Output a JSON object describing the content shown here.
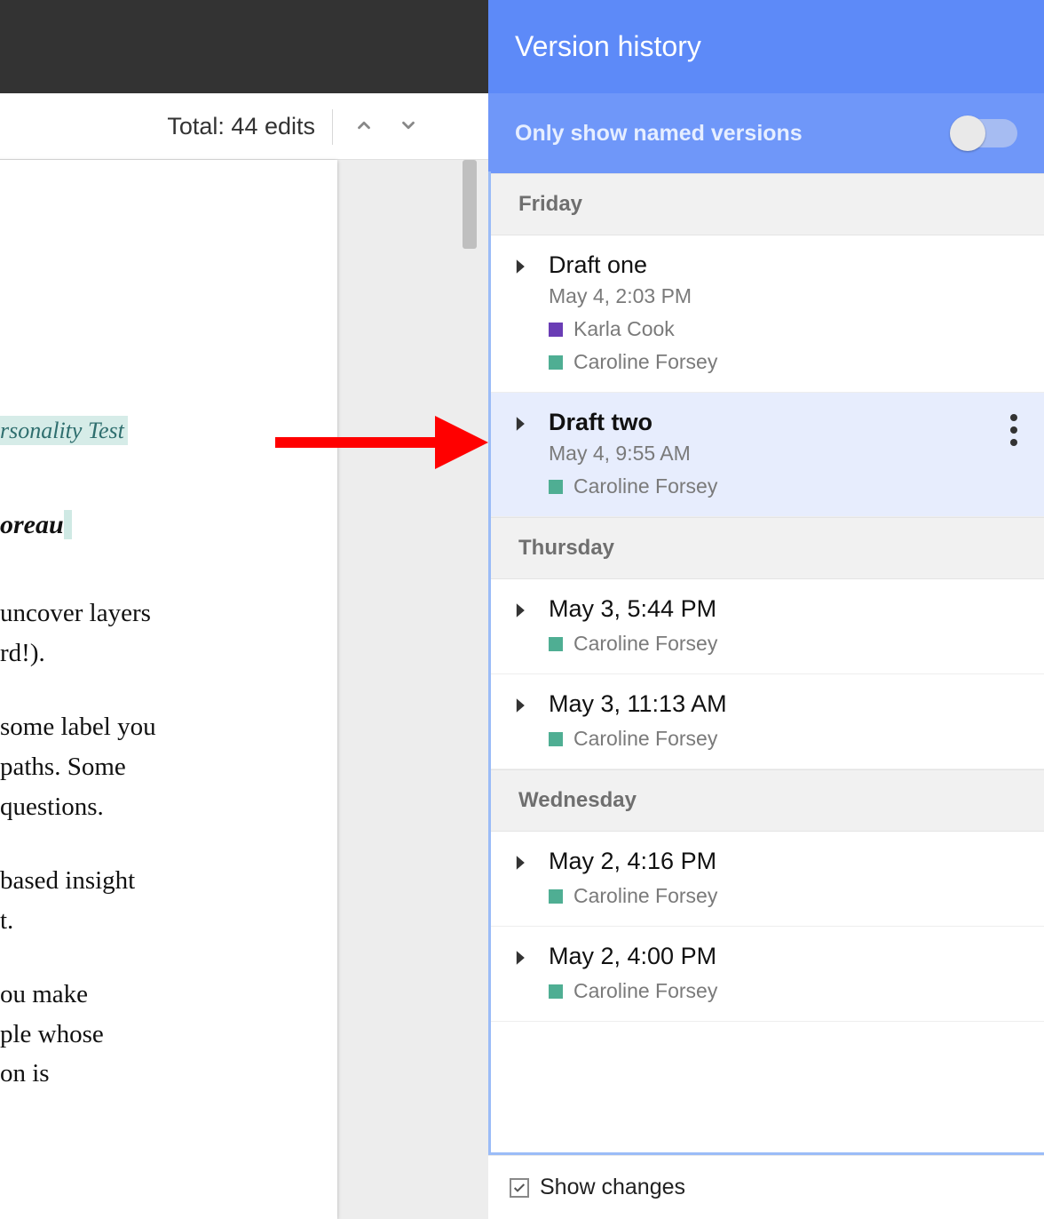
{
  "toolbar": {
    "total_edits_text": "Total: 44 edits"
  },
  "document": {
    "highlight_fragment": "rsonality Test",
    "author_fragment": "oreau",
    "body_fragments": [
      "uncover layers",
      "rd!).",
      "some label you",
      "paths. Some",
      "questions.",
      "based insight",
      "t.",
      "ou make",
      "ple whose",
      "on is"
    ]
  },
  "sidebar": {
    "title": "Version history",
    "filter_label": "Only show named versions",
    "filter_on": false,
    "show_changes_label": "Show changes",
    "show_changes_checked": true,
    "colors": {
      "karla": "#6a3db5",
      "caroline": "#4fae93"
    },
    "days": [
      {
        "label": "Friday",
        "versions": [
          {
            "name": "Draft one",
            "timestamp": "May 4, 2:03 PM",
            "selected": false,
            "editors": [
              {
                "name": "Karla Cook",
                "color_key": "karla"
              },
              {
                "name": "Caroline Forsey",
                "color_key": "caroline"
              }
            ]
          },
          {
            "name": "Draft two",
            "timestamp": "May 4, 9:55 AM",
            "selected": true,
            "editors": [
              {
                "name": "Caroline Forsey",
                "color_key": "caroline"
              }
            ]
          }
        ]
      },
      {
        "label": "Thursday",
        "versions": [
          {
            "name": "May 3, 5:44 PM",
            "timestamp": "",
            "selected": false,
            "editors": [
              {
                "name": "Caroline Forsey",
                "color_key": "caroline"
              }
            ]
          },
          {
            "name": "May 3, 11:13 AM",
            "timestamp": "",
            "selected": false,
            "editors": [
              {
                "name": "Caroline Forsey",
                "color_key": "caroline"
              }
            ]
          }
        ]
      },
      {
        "label": "Wednesday",
        "versions": [
          {
            "name": "May 2, 4:16 PM",
            "timestamp": "",
            "selected": false,
            "editors": [
              {
                "name": "Caroline Forsey",
                "color_key": "caroline"
              }
            ]
          },
          {
            "name": "May 2, 4:00 PM",
            "timestamp": "",
            "selected": false,
            "editors": [
              {
                "name": "Caroline Forsey",
                "color_key": "caroline"
              }
            ]
          }
        ]
      }
    ]
  }
}
